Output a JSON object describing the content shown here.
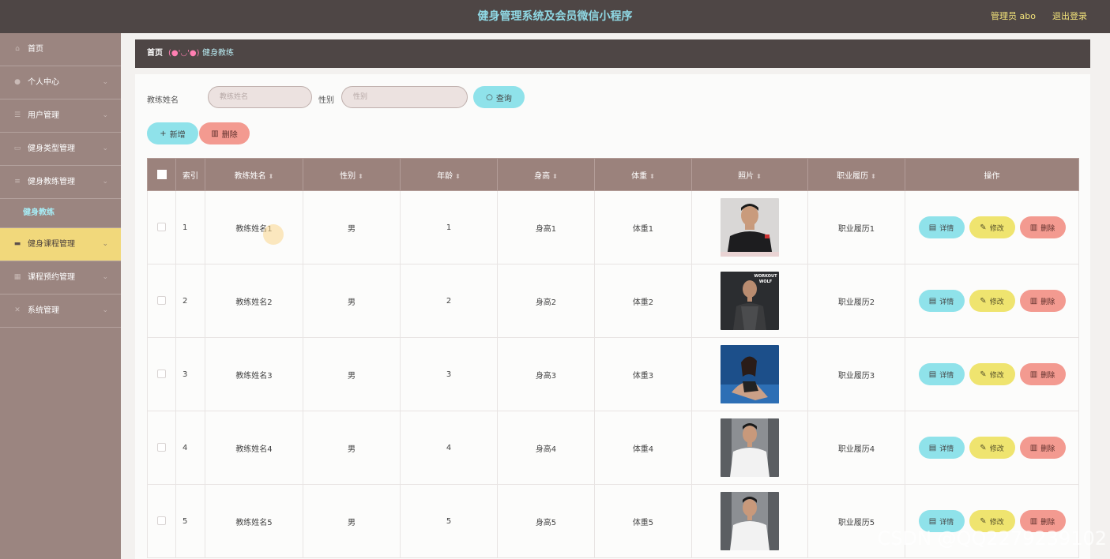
{
  "header": {
    "title": "健身管理系统及会员微信小程序",
    "admin": "管理员 abo",
    "logout": "退出登录"
  },
  "sidebar": {
    "items": [
      {
        "label": "首页",
        "icon": "home-icon",
        "glyph": "⌂",
        "chev": ""
      },
      {
        "label": "个人中心",
        "icon": "user-icon",
        "glyph": "●",
        "chev": "⌄"
      },
      {
        "label": "用户管理",
        "icon": "list-icon",
        "glyph": "☰",
        "chev": "⌄"
      },
      {
        "label": "健身类型管理",
        "icon": "card-icon",
        "glyph": "▭",
        "chev": "⌄"
      },
      {
        "label": "健身教练管理",
        "icon": "menu-icon",
        "glyph": "≡",
        "chev": "⌄"
      }
    ],
    "submenu": "健身教练",
    "items2": [
      {
        "label": "健身课程管理",
        "icon": "monitor-icon",
        "glyph": "▬",
        "chev": "⌄"
      },
      {
        "label": "课程预约管理",
        "icon": "grid-icon",
        "glyph": "▦",
        "chev": "⌄"
      },
      {
        "label": "系统管理",
        "icon": "settings-icon",
        "glyph": "✕",
        "chev": "⌄"
      }
    ]
  },
  "breadcrumb": {
    "home": "首页",
    "deco": "(●'◡'●)",
    "current": "健身教练"
  },
  "search": {
    "name_label": "教练姓名",
    "name_placeholder": "教练姓名",
    "gender_label": "性别",
    "gender_placeholder": "性别",
    "query": "查询"
  },
  "actions": {
    "add": "新增",
    "delete": "删除"
  },
  "table": {
    "headers": [
      "索引",
      "教练姓名",
      "性别",
      "年龄",
      "身高",
      "体重",
      "照片",
      "职业履历",
      "操作"
    ],
    "rows": [
      {
        "index": "1",
        "name": "教练姓名1",
        "gender": "男",
        "age": "1",
        "height": "身高1",
        "weight": "体重1",
        "career": "职业履历1"
      },
      {
        "index": "2",
        "name": "教练姓名2",
        "gender": "男",
        "age": "2",
        "height": "身高2",
        "weight": "体重2",
        "career": "职业履历2",
        "photo_text": "WORKOUT WOLF"
      },
      {
        "index": "3",
        "name": "教练姓名3",
        "gender": "男",
        "age": "3",
        "height": "身高3",
        "weight": "体重3",
        "career": "职业履历3"
      },
      {
        "index": "4",
        "name": "教练姓名4",
        "gender": "男",
        "age": "4",
        "height": "身高4",
        "weight": "体重4",
        "career": "职业履历4"
      },
      {
        "index": "5",
        "name": "教练姓名5",
        "gender": "男",
        "age": "5",
        "height": "身高5",
        "weight": "体重5",
        "career": "职业履历5"
      }
    ],
    "op_detail": "详情",
    "op_edit": "修改",
    "op_delete": "删除"
  },
  "colors": {
    "topbar": "#4e4645",
    "sidebar": "#9b8580",
    "active": "#f1d87b",
    "accent_cyan": "#8fe2ea",
    "accent_red": "#f39a90",
    "accent_yellow": "#efe46f"
  },
  "watermark": "CSDN @QQ2279239102"
}
